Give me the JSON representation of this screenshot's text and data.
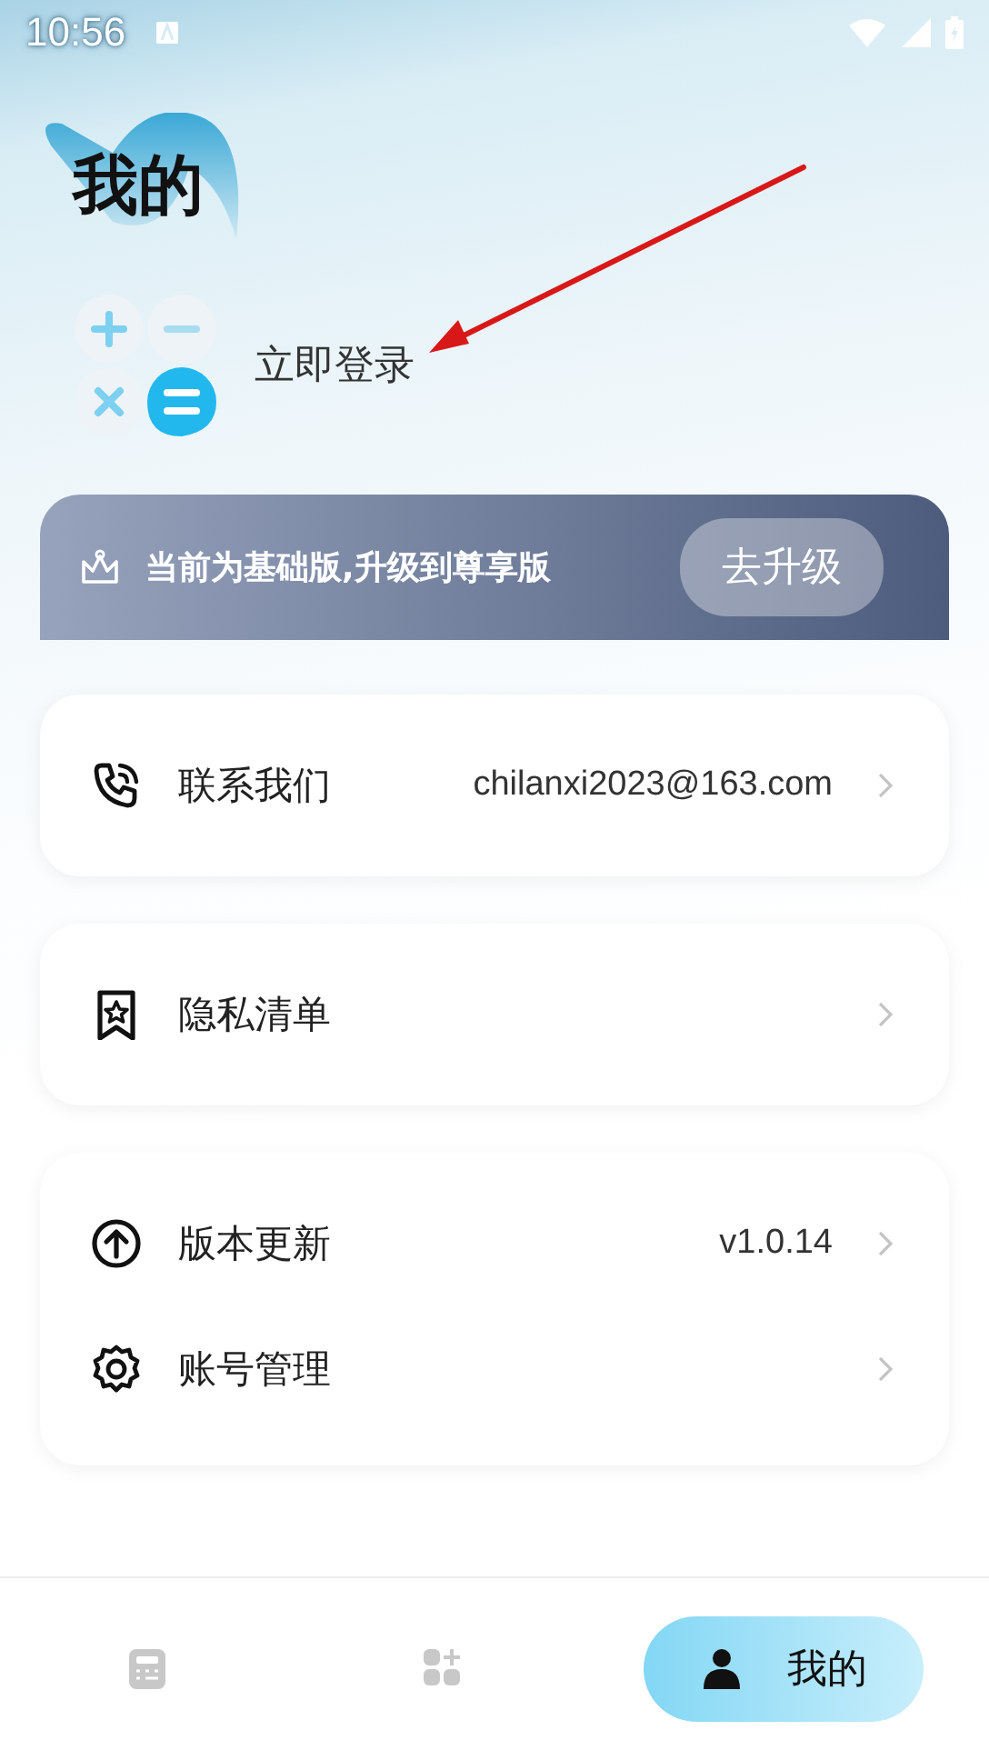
{
  "status_bar": {
    "time": "10:56"
  },
  "header": {
    "title": "我的"
  },
  "login": {
    "label": "立即登录"
  },
  "upgrade_banner": {
    "text": "当前为基础版,升级到尊享版",
    "button": "去升级"
  },
  "cards": [
    {
      "items": [
        {
          "kind": "phone",
          "label": "联系我们",
          "value": "chilanxi2023@163.com"
        }
      ]
    },
    {
      "items": [
        {
          "kind": "privacy",
          "label": "隐私清单"
        }
      ]
    },
    {
      "items": [
        {
          "kind": "update",
          "label": "版本更新",
          "value": "v1.0.14"
        },
        {
          "kind": "account",
          "label": "账号管理"
        }
      ]
    }
  ],
  "bottom_nav": [
    {
      "kind": "calculator",
      "selected": false
    },
    {
      "kind": "apps",
      "selected": false
    },
    {
      "kind": "profile",
      "label": "我的",
      "selected": true
    }
  ]
}
